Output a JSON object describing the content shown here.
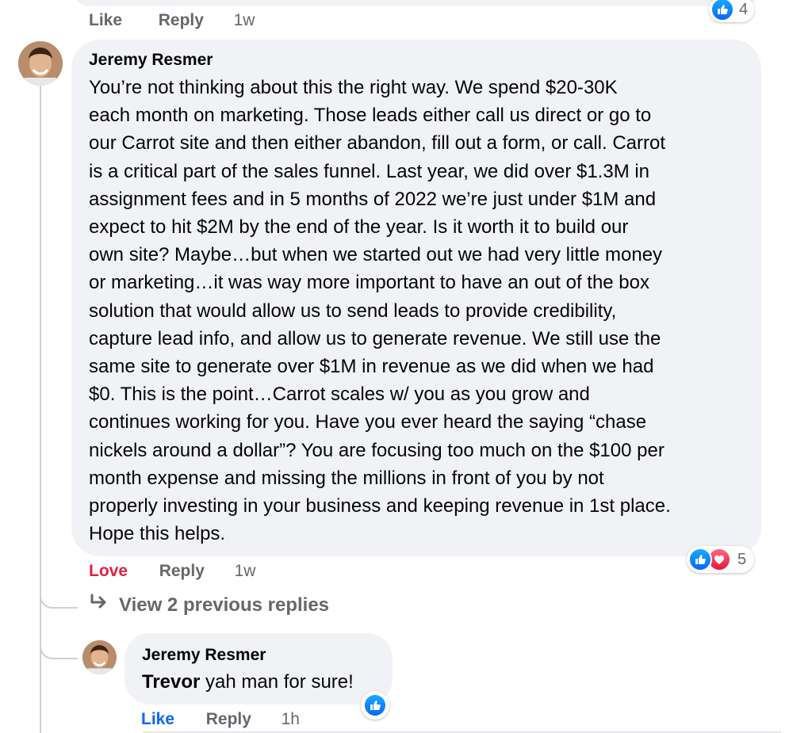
{
  "top_comment": {
    "actions": {
      "like": "Like",
      "reply": "Reply",
      "time": "1w"
    },
    "reaction_count": "4"
  },
  "main_comment": {
    "author": "Jeremy Resmer",
    "lines": [
      "You’re not thinking about this the right way. We spend $20-30K",
      "each month on marketing. Those leads either call us direct or go to",
      "our Carrot site and then either abandon, fill out a form, or call. Carrot",
      "is a critical part of the sales funnel. Last year, we did over $1.3M in",
      "assignment fees and in 5 months of 2022 we’re just under $1M and",
      "expect to hit $2M by the end of the year. Is it worth it to build our",
      "own site? Maybe…but when we started out we had very little money",
      "or marketing…it was way more important to have an out of the box",
      "solution that would allow us to send leads to provide credibility,",
      "capture lead info, and allow us to generate revenue. We still use the",
      "same site to generate over $1M in revenue as we did when we had",
      "$0. This is the point…Carrot scales w/ you as you grow and",
      "continues working for you. Have you ever heard the saying “chase",
      "nickels around a dollar”? You are focusing too much on the $100 per",
      "month expense and missing the millions in front of you by not",
      "properly investing in your business and keeping revenue in 1st place.",
      "Hope this helps."
    ],
    "reaction_count": "5",
    "actions": {
      "love": "Love",
      "reply": "Reply",
      "time": "1w"
    }
  },
  "view_replies": {
    "icon": "reply-arrow-icon",
    "label": "View 2 previous replies"
  },
  "reply": {
    "author": "Jeremy Resmer",
    "mention": "Trevor",
    "text": " yah man for sure!",
    "actions": {
      "like": "Like",
      "reply": "Reply",
      "time": "1h"
    }
  },
  "colors": {
    "like_blue": "#0866ff",
    "love_red": "#e41e3f",
    "bubble": "#f0f2f5",
    "muted": "#65676b"
  }
}
